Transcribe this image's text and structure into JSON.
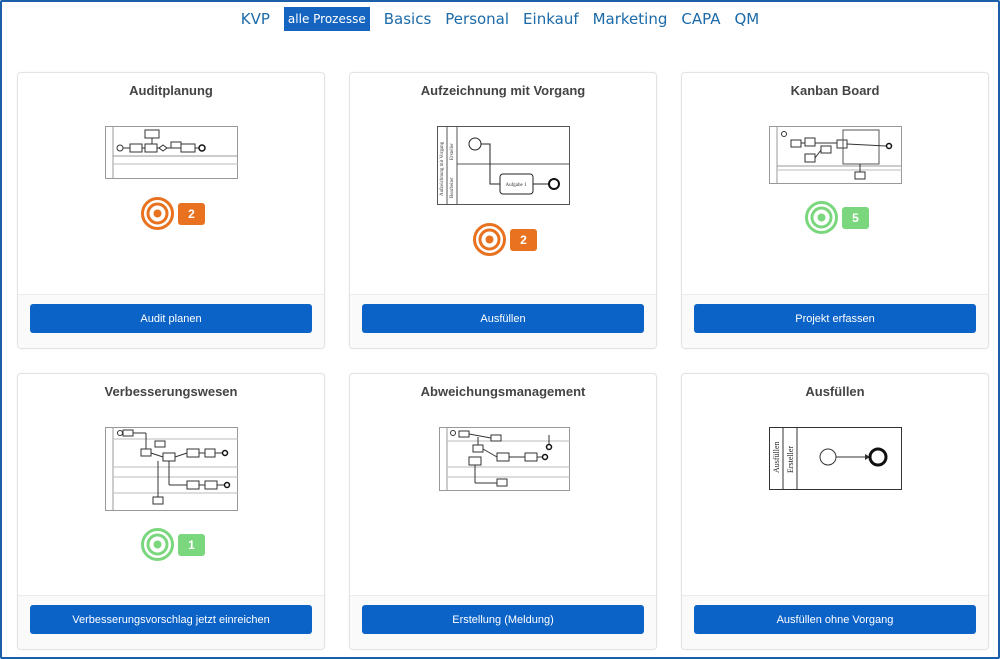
{
  "nav": {
    "items": [
      {
        "label": "KVP"
      },
      {
        "label": "alle Prozesse",
        "active": true
      },
      {
        "label": "Basics"
      },
      {
        "label": "Personal"
      },
      {
        "label": "Einkauf"
      },
      {
        "label": "Marketing"
      },
      {
        "label": "CAPA"
      },
      {
        "label": "QM"
      }
    ]
  },
  "cards": [
    {
      "title": "Auditplanung",
      "button": "Audit planen",
      "count": "2",
      "status_color": "#e8721f",
      "icon": "target-icon"
    },
    {
      "title": "Aufzeichnung mit Vorgang",
      "button": "Ausfüllen",
      "count": "2",
      "status_color": "#e8721f",
      "icon": "target-icon",
      "diagram": {
        "lane_top": "Aufzeichnung mit Vorgang",
        "lane_sub1": "Ersteller",
        "lane_sub2": "Bearbeiter",
        "task": "Aufgabe 1"
      }
    },
    {
      "title": "Kanban Board",
      "button": "Projekt erfassen",
      "count": "5",
      "status_color": "#7bd77e",
      "icon": "target-icon"
    },
    {
      "title": "Verbesserungswesen",
      "button": "Verbesserungsvorschlag jetzt einreichen",
      "count": "1",
      "status_color": "#7bd77e",
      "icon": "target-icon"
    },
    {
      "title": "Abweichungsmanagement",
      "button": "Erstellung (Meldung)"
    },
    {
      "title": "Ausfüllen",
      "button": "Ausfüllen ohne Vorgang",
      "diagram": {
        "lane_top": "Ausfüllen",
        "lane_sub1": "Ersteller"
      }
    }
  ],
  "colors": {
    "primary": "#0b63c8",
    "nav_link": "#1c6aa8",
    "orange": "#e8721f",
    "green": "#7bd77e",
    "frame": "#1a5fa8"
  }
}
